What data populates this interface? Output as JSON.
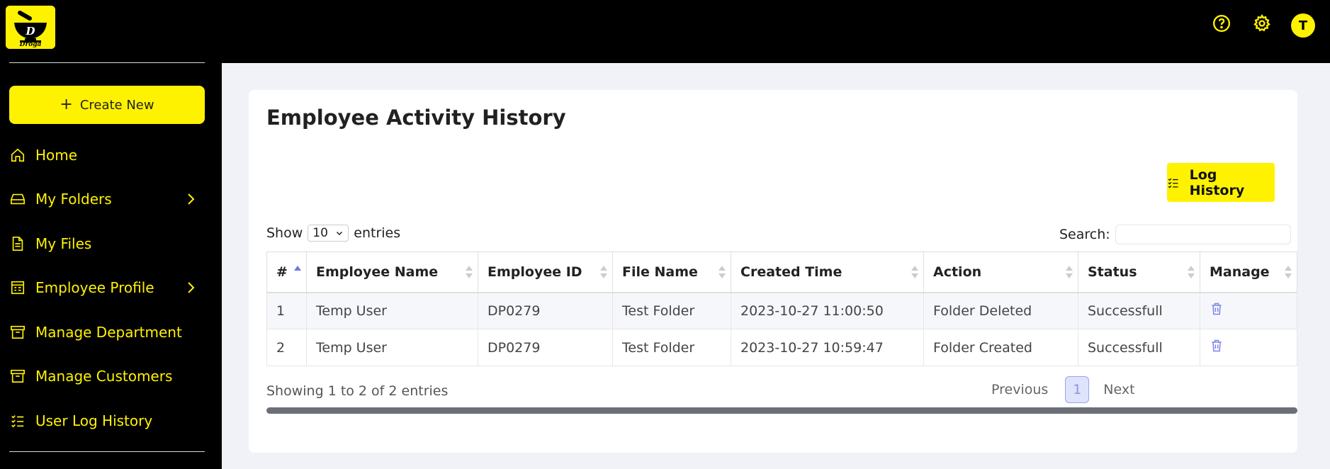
{
  "brand": {
    "logo_text": "Droga",
    "accent": "#fff200"
  },
  "sidebar": {
    "create_label": "Create New",
    "items": [
      {
        "label": "Home",
        "icon": "home-icon"
      },
      {
        "label": "My Folders",
        "icon": "drive-icon",
        "has_submenu": true
      },
      {
        "label": "My Files",
        "icon": "file-icon"
      },
      {
        "label": "Employee Profile",
        "icon": "profile-icon",
        "has_submenu": true
      },
      {
        "label": "Manage Department",
        "icon": "archive-icon"
      },
      {
        "label": "Manage Customers",
        "icon": "archive-icon"
      },
      {
        "label": "User Log History",
        "icon": "checklist-icon"
      }
    ]
  },
  "topbar": {
    "avatar_initial": "T",
    "icons": [
      "help-icon",
      "settings-icon"
    ]
  },
  "main": {
    "title": "Employee Activity History",
    "log_history_label": "Log History",
    "show_label": "Show",
    "entries_value": "10",
    "entries_label": "entries",
    "search_label": "Search:",
    "search_value": "",
    "columns": [
      "#",
      "Employee Name",
      "Employee ID",
      "File Name",
      "Created Time",
      "Action",
      "Status",
      "Manage"
    ],
    "rows": [
      {
        "no": "1",
        "name": "Temp User",
        "id": "DP0279",
        "file": "Test Folder",
        "time": "2023-10-27 11:00:50",
        "action": "Folder Deleted",
        "status": "Successfull"
      },
      {
        "no": "2",
        "name": "Temp User",
        "id": "DP0279",
        "file": "Test Folder",
        "time": "2023-10-27 10:59:47",
        "action": "Folder Created",
        "status": "Successfull"
      }
    ],
    "info": "Showing 1 to 2 of 2 entries",
    "pager": {
      "previous": "Previous",
      "current": "1",
      "next": "Next"
    }
  }
}
